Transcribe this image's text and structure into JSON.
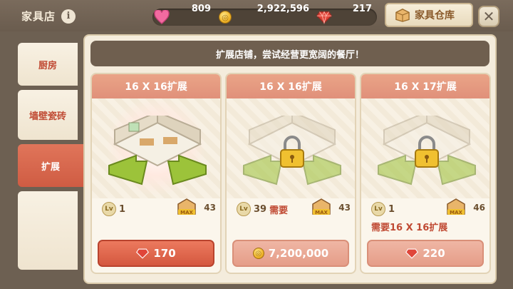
{
  "header": {
    "title": "家具店",
    "info_icon": "info-icon",
    "hearts": "809",
    "coins": "2,922,596",
    "gems": "217",
    "warehouse_label": "家具仓库",
    "close_icon": "close-icon"
  },
  "colors": {
    "accent": "#d4573f",
    "muted_button": "#e59d88",
    "card_header": "#e0907a",
    "banner": "#6f5f4f"
  },
  "sidebar": {
    "items": [
      {
        "label": "厨房",
        "active": false
      },
      {
        "label": "墙壁瓷砖",
        "active": false
      },
      {
        "label": "扩展",
        "active": true
      }
    ]
  },
  "banner": {
    "text": "扩展店铺，尝试经营更宽阔的餐厅！"
  },
  "cards": [
    {
      "title": "16 X 16扩展",
      "level": "1",
      "level_note": "",
      "max_count": "43",
      "extra_requirement": "",
      "price": "170",
      "currency_icon": "gem-icon",
      "locked": false
    },
    {
      "title": "16 X 16扩展",
      "level": "39",
      "level_note": "需要",
      "max_count": "43",
      "extra_requirement": "",
      "price": "7,200,000",
      "currency_icon": "coin-icon",
      "locked": true
    },
    {
      "title": "16 X 17扩展",
      "level": "1",
      "level_note": "",
      "max_count": "46",
      "extra_requirement": "需要16 X 16扩展",
      "price": "220",
      "currency_icon": "gem-icon",
      "locked": true
    }
  ]
}
